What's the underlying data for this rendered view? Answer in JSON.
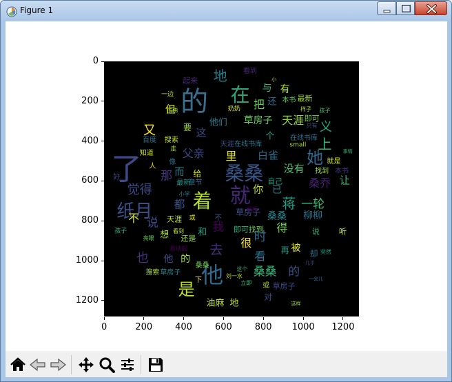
{
  "window": {
    "title": "Figure 1",
    "minimize_glyph": "minimize-icon",
    "maximize_glyph": "maximize-icon",
    "close_glyph": "close-icon"
  },
  "chart_data": {
    "type": "wordcloud",
    "xlim": [
      0,
      1280
    ],
    "ylim": [
      1280,
      0
    ],
    "xticks": [
      "0",
      "200",
      "400",
      "600",
      "800",
      "1000",
      "1200"
    ],
    "yticks": [
      "0",
      "200",
      "400",
      "600",
      "800",
      "1000",
      "1200"
    ],
    "background": "#000000",
    "words": [
      {
        "text": "的",
        "x": 450,
        "y": 200,
        "size": 40,
        "color": "#3b6e8f"
      },
      {
        "text": "在",
        "x": 680,
        "y": 165,
        "size": 28,
        "color": "#2fa37e"
      },
      {
        "text": "地",
        "x": 580,
        "y": 70,
        "size": 20,
        "color": "#26828e"
      },
      {
        "text": "与",
        "x": 815,
        "y": 130,
        "size": 14,
        "color": "#35b779"
      },
      {
        "text": "有",
        "x": 905,
        "y": 140,
        "size": 14,
        "color": "#b5de2b"
      },
      {
        "text": "把",
        "x": 775,
        "y": 215,
        "size": 16,
        "color": "#6ece58"
      },
      {
        "text": "还",
        "x": 840,
        "y": 200,
        "size": 13,
        "color": "#31688e"
      },
      {
        "text": "最新",
        "x": 1005,
        "y": 185,
        "size": 11,
        "color": "#a2da37"
      },
      {
        "text": "本书",
        "x": 925,
        "y": 195,
        "size": 10,
        "color": "#5ec962"
      },
      {
        "text": "但",
        "x": 330,
        "y": 240,
        "size": 15,
        "color": "#dde318"
      },
      {
        "text": "起来",
        "x": 430,
        "y": 95,
        "size": 11,
        "color": "#482878"
      },
      {
        "text": "看到",
        "x": 730,
        "y": 50,
        "size": 10,
        "color": "#482475"
      },
      {
        "text": "一边",
        "x": 315,
        "y": 165,
        "size": 9,
        "color": "#bddf26"
      },
      {
        "text": "他们",
        "x": 570,
        "y": 305,
        "size": 13,
        "color": "#287c8e"
      },
      {
        "text": "草房子",
        "x": 770,
        "y": 295,
        "size": 14,
        "color": "#67cc5c"
      },
      {
        "text": "天涯",
        "x": 945,
        "y": 295,
        "size": 16,
        "color": "#90d743"
      },
      {
        "text": "即可",
        "x": 1040,
        "y": 285,
        "size": 11,
        "color": "#7ad151"
      },
      {
        "text": "要",
        "x": 415,
        "y": 330,
        "size": 12,
        "color": "#a5db36"
      },
      {
        "text": "这",
        "x": 485,
        "y": 355,
        "size": 15,
        "color": "#3e4a89"
      },
      {
        "text": "个",
        "x": 830,
        "y": 375,
        "size": 13,
        "color": "#20a486"
      },
      {
        "text": "又",
        "x": 225,
        "y": 345,
        "size": 18,
        "color": "#fde725"
      },
      {
        "text": "义",
        "x": 1110,
        "y": 330,
        "size": 18,
        "color": "#22a884"
      },
      {
        "text": "上",
        "x": 1105,
        "y": 410,
        "size": 20,
        "color": "#35b779"
      },
      {
        "text": "搜索",
        "x": 335,
        "y": 395,
        "size": 10,
        "color": "#c0df25"
      },
      {
        "text": "百度",
        "x": 225,
        "y": 395,
        "size": 10,
        "color": "#2c728e"
      },
      {
        "text": "在线书库",
        "x": 1000,
        "y": 385,
        "size": 10,
        "color": "#2e6f8e"
      },
      {
        "text": "small",
        "x": 970,
        "y": 420,
        "size": 9,
        "color": "#addc30"
      },
      {
        "text": "她",
        "x": 1055,
        "y": 480,
        "size": 24,
        "color": "#31688e"
      },
      {
        "text": "白雀",
        "x": 820,
        "y": 470,
        "size": 15,
        "color": "#31688e"
      },
      {
        "text": "里",
        "x": 635,
        "y": 475,
        "size": 16,
        "color": "#dde318"
      },
      {
        "text": "天涯",
        "x": 615,
        "y": 415,
        "size": 10,
        "color": "#39568c"
      },
      {
        "text": "在线书库",
        "x": 720,
        "y": 415,
        "size": 10,
        "color": "#2a788e"
      },
      {
        "text": "知道",
        "x": 210,
        "y": 460,
        "size": 10,
        "color": "#cde11d"
      },
      {
        "text": "父亲",
        "x": 445,
        "y": 460,
        "size": 16,
        "color": "#3f4889"
      },
      {
        "text": "了",
        "x": 110,
        "y": 540,
        "size": 44,
        "color": "#3e4a89"
      },
      {
        "text": "桑桑",
        "x": 700,
        "y": 560,
        "size": 28,
        "color": "#38588c"
      },
      {
        "text": "没有",
        "x": 950,
        "y": 535,
        "size": 15,
        "color": "#4ac16d"
      },
      {
        "text": "找到",
        "x": 1090,
        "y": 550,
        "size": 10,
        "color": "#9bd93c"
      },
      {
        "text": "本书",
        "x": 1190,
        "y": 550,
        "size": 10,
        "color": "#46337f"
      },
      {
        "text": "就是",
        "x": 1150,
        "y": 500,
        "size": 10,
        "color": "#d0e11c"
      },
      {
        "text": "那",
        "x": 310,
        "y": 575,
        "size": 17,
        "color": "#46337f"
      },
      {
        "text": "而",
        "x": 375,
        "y": 555,
        "size": 14,
        "color": "#26828e"
      },
      {
        "text": "给",
        "x": 465,
        "y": 560,
        "size": 12,
        "color": "#d2e21b"
      },
      {
        "text": "最新",
        "x": 395,
        "y": 610,
        "size": 10,
        "color": "#20928c"
      },
      {
        "text": "章节",
        "x": 455,
        "y": 610,
        "size": 10,
        "color": "#2d708e"
      },
      {
        "text": "桑乔",
        "x": 1080,
        "y": 610,
        "size": 16,
        "color": "#482173"
      },
      {
        "text": "让",
        "x": 1205,
        "y": 595,
        "size": 15,
        "color": "#3dbc74"
      },
      {
        "text": "自己",
        "x": 855,
        "y": 600,
        "size": 11,
        "color": "#1f9e89"
      },
      {
        "text": "觉得",
        "x": 175,
        "y": 645,
        "size": 18,
        "color": "#3e4a89"
      },
      {
        "text": "纸月",
        "x": 150,
        "y": 750,
        "size": 26,
        "color": "#3b528b"
      },
      {
        "text": "着",
        "x": 490,
        "y": 700,
        "size": 28,
        "color": "#b5de2b"
      },
      {
        "text": "就",
        "x": 680,
        "y": 675,
        "size": 30,
        "color": "#482878"
      },
      {
        "text": "你",
        "x": 770,
        "y": 640,
        "size": 15,
        "color": "#c2df23"
      },
      {
        "text": "已",
        "x": 865,
        "y": 645,
        "size": 14,
        "color": "#25858e"
      },
      {
        "text": "都",
        "x": 375,
        "y": 715,
        "size": 16,
        "color": "#3b528b"
      },
      {
        "text": "一轮",
        "x": 1045,
        "y": 715,
        "size": 17,
        "color": "#3dbc74"
      },
      {
        "text": "蒋",
        "x": 925,
        "y": 710,
        "size": 20,
        "color": "#1fa088"
      },
      {
        "text": "柳柳",
        "x": 1045,
        "y": 770,
        "size": 14,
        "color": "#2c728e"
      },
      {
        "text": "桑桑",
        "x": 865,
        "y": 775,
        "size": 14,
        "color": "#26828e"
      },
      {
        "text": "草房子",
        "x": 720,
        "y": 755,
        "size": 12,
        "color": "#3b528b"
      },
      {
        "text": "不",
        "x": 145,
        "y": 785,
        "size": 16,
        "color": "#d8e219"
      },
      {
        "text": "说",
        "x": 240,
        "y": 810,
        "size": 17,
        "color": "#3e4989"
      },
      {
        "text": "我",
        "x": 570,
        "y": 830,
        "size": 17,
        "color": "#440154"
      },
      {
        "text": "天涯",
        "x": 350,
        "y": 790,
        "size": 11,
        "color": "#bade28"
      },
      {
        "text": "得",
        "x": 890,
        "y": 835,
        "size": 16,
        "color": "#6ece58"
      },
      {
        "text": "即可",
        "x": 685,
        "y": 840,
        "size": 11,
        "color": "#2db27d"
      },
      {
        "text": "找到",
        "x": 760,
        "y": 840,
        "size": 11,
        "color": "#75d054"
      },
      {
        "text": "想",
        "x": 300,
        "y": 870,
        "size": 13,
        "color": "#addc30"
      },
      {
        "text": "和",
        "x": 490,
        "y": 855,
        "size": 13,
        "color": "#20a486"
      },
      {
        "text": "还是",
        "x": 420,
        "y": 885,
        "size": 11,
        "color": "#93d741"
      },
      {
        "text": "很",
        "x": 710,
        "y": 910,
        "size": 16,
        "color": "#fde725"
      },
      {
        "text": "时",
        "x": 780,
        "y": 880,
        "size": 18,
        "color": "#31688e"
      },
      {
        "text": "去",
        "x": 560,
        "y": 945,
        "size": 19,
        "color": "#46337f"
      },
      {
        "text": "被",
        "x": 960,
        "y": 935,
        "size": 14,
        "color": "#dae319"
      },
      {
        "text": "再",
        "x": 905,
        "y": 945,
        "size": 12,
        "color": "#1f9e89"
      },
      {
        "text": "也",
        "x": 190,
        "y": 985,
        "size": 18,
        "color": "#46337f"
      },
      {
        "text": "他",
        "x": 320,
        "y": 990,
        "size": 14,
        "color": "#3e4989"
      },
      {
        "text": "的",
        "x": 405,
        "y": 990,
        "size": 14,
        "color": "#a2da37"
      },
      {
        "text": "看",
        "x": 780,
        "y": 975,
        "size": 16,
        "color": "#2c728e"
      },
      {
        "text": "他",
        "x": 540,
        "y": 1070,
        "size": 32,
        "color": "#31688e"
      },
      {
        "text": "桑桑",
        "x": 805,
        "y": 1055,
        "size": 17,
        "color": "#2fb47c"
      },
      {
        "text": "的",
        "x": 950,
        "y": 1055,
        "size": 17,
        "color": "#3b528b"
      },
      {
        "text": "搜索",
        "x": 240,
        "y": 1060,
        "size": 10,
        "color": "#addc30"
      },
      {
        "text": "草房子",
        "x": 330,
        "y": 1060,
        "size": 10,
        "color": "#25848e"
      },
      {
        "text": "是",
        "x": 410,
        "y": 1140,
        "size": 24,
        "color": "#c0df25"
      },
      {
        "text": "油麻",
        "x": 555,
        "y": 1210,
        "size": 13,
        "color": "#bfdf25"
      },
      {
        "text": "地",
        "x": 650,
        "y": 1210,
        "size": 13,
        "color": "#c2df23"
      },
      {
        "text": "对",
        "x": 820,
        "y": 1180,
        "size": 12,
        "color": "#3d4e8a"
      },
      {
        "text": "草房子",
        "x": 900,
        "y": 1125,
        "size": 11,
        "color": "#3f4889"
      },
      {
        "text": "或",
        "x": 810,
        "y": 1125,
        "size": 10,
        "color": "#b8de29"
      },
      {
        "text": "桑桑",
        "x": 490,
        "y": 1025,
        "size": 10,
        "color": "#7ad151"
      },
      {
        "text": "说",
        "x": 1060,
        "y": 850,
        "size": 11,
        "color": "#35b779"
      },
      {
        "text": "听",
        "x": 1195,
        "y": 850,
        "size": 11,
        "color": "#cae11f"
      },
      {
        "text": "却",
        "x": 1050,
        "y": 960,
        "size": 12,
        "color": "#2c728e"
      },
      {
        "text": "好",
        "x": 60,
        "y": 580,
        "size": 10,
        "color": "#3e4a89"
      },
      {
        "text": "人",
        "x": 240,
        "y": 525,
        "size": 10,
        "color": "#e5e419"
      },
      {
        "text": "孩子",
        "x": 80,
        "y": 850,
        "size": 9,
        "color": "#2fb47c"
      },
      {
        "text": "不",
        "x": 570,
        "y": 785,
        "size": 10,
        "color": "#3b528b"
      },
      {
        "text": "像",
        "x": 340,
        "y": 505,
        "size": 10,
        "color": "#2d708e"
      },
      {
        "text": "下",
        "x": 470,
        "y": 1095,
        "size": 10,
        "color": "#fde725"
      },
      {
        "text": "奶奶",
        "x": 650,
        "y": 240,
        "size": 9,
        "color": "#dde318"
      },
      {
        "text": "样子",
        "x": 1010,
        "y": 240,
        "size": 8,
        "color": "#bade28"
      },
      {
        "text": "孩子",
        "x": 1105,
        "y": 245,
        "size": 8,
        "color": "#4ac16d"
      },
      {
        "text": "仿佛",
        "x": 340,
        "y": 245,
        "size": 8,
        "color": "#a8db34"
      },
      {
        "text": "只有",
        "x": 1040,
        "y": 320,
        "size": 8,
        "color": "#3b528b"
      },
      {
        "text": "走",
        "x": 345,
        "y": 440,
        "size": 9,
        "color": "#b5de2b"
      },
      {
        "text": "小学",
        "x": 400,
        "y": 665,
        "size": 8,
        "color": "#26828e"
      },
      {
        "text": "最新",
        "x": 740,
        "y": 740,
        "size": 8,
        "color": "#440154"
      },
      {
        "text": "或",
        "x": 440,
        "y": 785,
        "size": 9,
        "color": "#dde318"
      },
      {
        "text": "看到",
        "x": 370,
        "y": 850,
        "size": 8,
        "color": "#c2df23"
      },
      {
        "text": "亮眼",
        "x": 220,
        "y": 885,
        "size": 8,
        "color": "#6ece58"
      },
      {
        "text": "激动起",
        "x": 370,
        "y": 940,
        "size": 9,
        "color": "#440154"
      },
      {
        "text": "这个",
        "x": 690,
        "y": 1040,
        "size": 8,
        "color": "#2db27d"
      },
      {
        "text": "立即",
        "x": 710,
        "y": 1110,
        "size": 8,
        "color": "#35b779"
      },
      {
        "text": "小",
        "x": 850,
        "y": 90,
        "size": 7,
        "color": "#bfdf25"
      },
      {
        "text": "几乎",
        "x": 1030,
        "y": 1010,
        "size": 7,
        "color": "#3e4a89"
      },
      {
        "text": "一会儿",
        "x": 1060,
        "y": 1090,
        "size": 7,
        "color": "#31688e"
      },
      {
        "text": "这样",
        "x": 960,
        "y": 1215,
        "size": 7,
        "color": "#a2da37"
      },
      {
        "text": "事情",
        "x": 1220,
        "y": 450,
        "size": 7,
        "color": "#2fb47c"
      },
      {
        "text": "刘一水",
        "x": 650,
        "y": 1075,
        "size": 8,
        "color": "#c2df23"
      },
      {
        "text": "突然",
        "x": 1110,
        "y": 955,
        "size": 8,
        "color": "#20a486"
      }
    ]
  },
  "toolbar": {
    "buttons": [
      {
        "name": "home-button",
        "icon": "home-icon"
      },
      {
        "name": "back-button",
        "icon": "arrow-left-icon"
      },
      {
        "name": "forward-button",
        "icon": "arrow-right-icon"
      },
      {
        "name": "pan-button",
        "icon": "move-icon"
      },
      {
        "name": "zoom-button",
        "icon": "magnifier-icon"
      },
      {
        "name": "configure-subplots-button",
        "icon": "sliders-icon"
      },
      {
        "name": "save-button",
        "icon": "floppy-icon"
      }
    ]
  }
}
